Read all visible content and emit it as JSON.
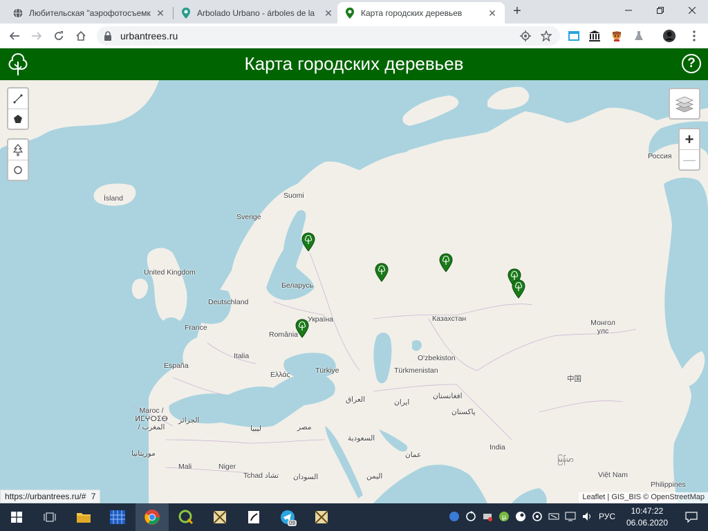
{
  "browser": {
    "tabs": [
      {
        "title": "Любительская \"аэрофотосъемк",
        "active": false
      },
      {
        "title": "Arbolado Urbano - árboles de la",
        "active": false
      },
      {
        "title": "Карта городских деревьев",
        "active": true
      }
    ],
    "url": "urbantrees.ru",
    "status_url": "https://urbantrees.ru/#"
  },
  "app": {
    "title": "Карта городских деревьев",
    "help_label": "?"
  },
  "map": {
    "zoom_in": "+",
    "zoom_out": "—",
    "attribution": "Leaflet | GIS_BIS © OpenStreetMap",
    "status_overflow": "7",
    "labels": {
      "russia": "Россия",
      "island": "Ísland",
      "suomi": "Suomi",
      "sverige": "Sverige",
      "uk": "United Kingdom",
      "belarus": "Беларусь",
      "deutschland": "Deutschland",
      "france": "France",
      "ukraina": "Україна",
      "romania": "România",
      "kazakhstan": "Казахстан",
      "mongolia": "Монгол улс",
      "uzbekistan": "O'zbekiston",
      "turkmenistan": "Türkmenistan",
      "italia": "Italia",
      "espana": "España",
      "ellas": "Ελλάς",
      "turkiye": "Türkiye",
      "china": "中国",
      "iraq": "العراق",
      "iran": "ایران",
      "afghanistan": "افغانستان",
      "pakistan": "پاکستان",
      "maroc": "Maroc / ⵍⵎⵖⵔⵉⴱ / المغرب",
      "algeria": "الجزائر",
      "libya": "ليبيا",
      "egypt": "مصر",
      "saudi": "السعودية",
      "oman": "عمان",
      "india": "India",
      "mauritania": "موريتانيا",
      "mali": "Mali",
      "niger": "Niger",
      "tchad": "Tchad تشاد",
      "sudan": "السودان",
      "yemen": "اليمن",
      "vietnam": "Việt Nam",
      "philippines": "Philippines",
      "myanmar": "မြန်မာ"
    },
    "marker_count": 7
  },
  "taskbar": {
    "lang": "РУС",
    "time": "10:47:22",
    "date": "06.06.2020",
    "telegram_badge": "09"
  },
  "colors": {
    "header": "#006400",
    "marker": "#1a7a1a",
    "water": "#aad3df",
    "land": "#f2efe9"
  }
}
